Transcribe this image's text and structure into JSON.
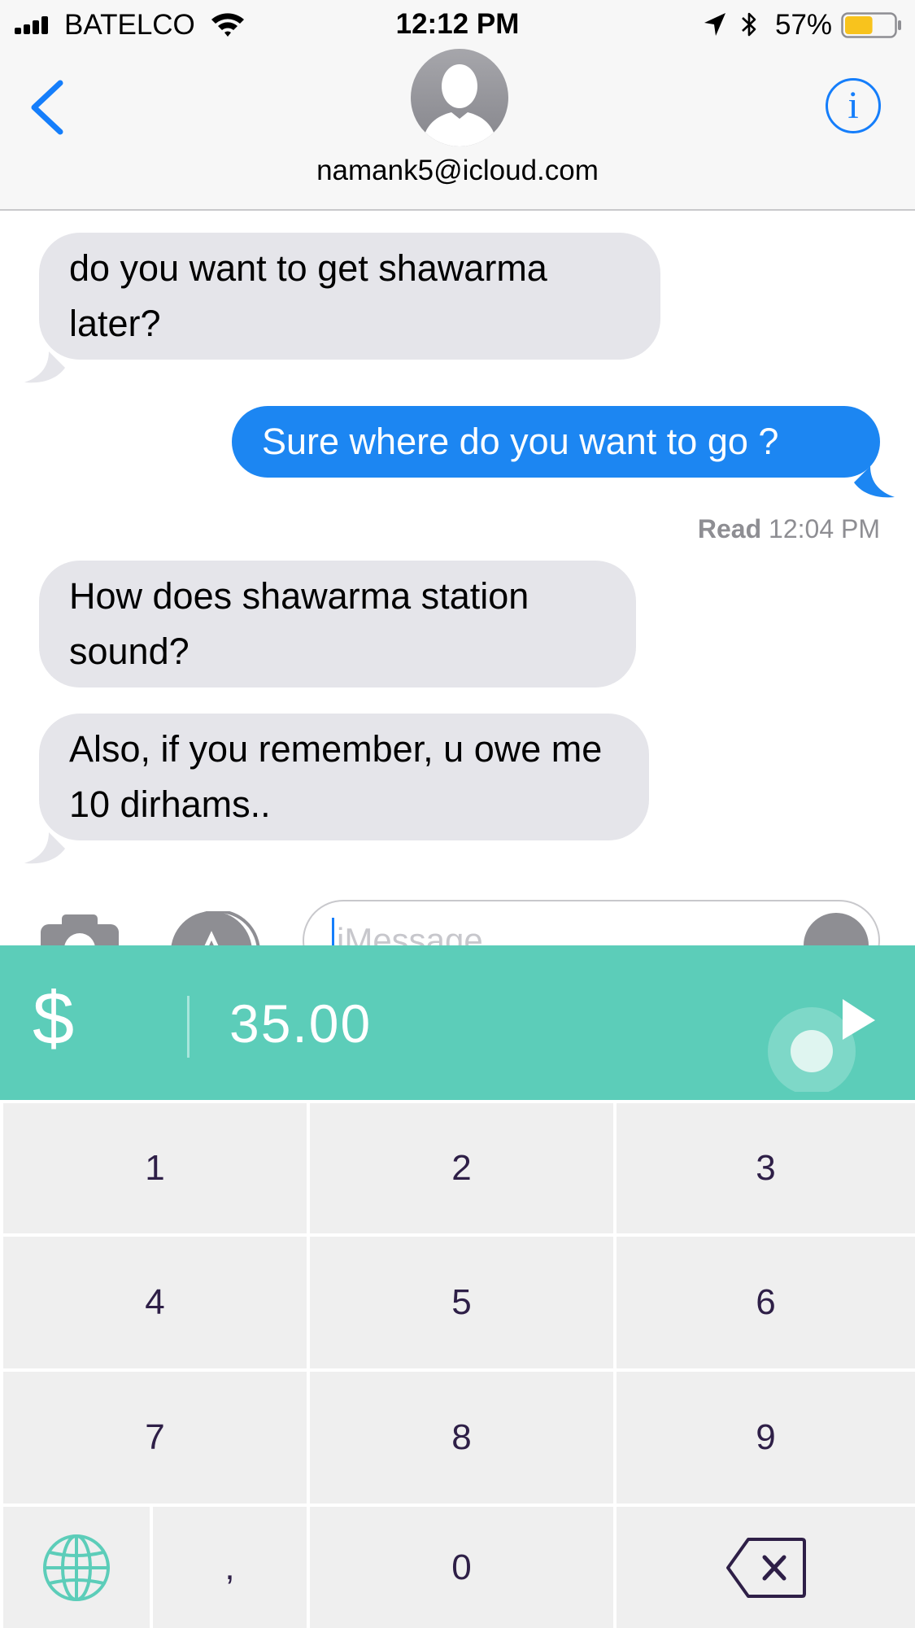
{
  "status_bar": {
    "carrier": "BATELCO",
    "time": "12:12 PM",
    "battery_percent": "57%",
    "battery_level": 0.57,
    "icons": [
      "signal-icon",
      "wifi-icon",
      "location-arrow-icon",
      "bluetooth-icon",
      "battery-icon"
    ]
  },
  "header": {
    "contact": "namank5@icloud.com",
    "back_icon": "chevron-left-icon",
    "info_label": "i",
    "avatar_icon": "person-silhouette-icon"
  },
  "messages": [
    {
      "direction": "incoming",
      "text": "do you want to get shawarma later?"
    },
    {
      "direction": "outgoing",
      "text": "Sure where do you want to go ?"
    },
    {
      "direction": "incoming",
      "text": "How does shawarma station sound?"
    },
    {
      "direction": "incoming",
      "text": "Also, if you remember, u owe me 10 dirhams.."
    }
  ],
  "read_receipt": {
    "label": "Read",
    "time": "12:04 PM"
  },
  "compose": {
    "placeholder": "iMessage",
    "icons": [
      "camera-icon",
      "app-store-icon",
      "microphone-icon"
    ]
  },
  "payment": {
    "currency": "$",
    "amount": "35.00",
    "send_icon": "play-arrow-icon"
  },
  "keypad": {
    "keys": [
      "1",
      "2",
      "3",
      "4",
      "5",
      "6",
      "7",
      "8",
      "9",
      ",",
      "0"
    ],
    "icons": [
      "globe-icon",
      "backspace-icon"
    ]
  },
  "colors": {
    "ios_blue": "#157efb",
    "outgoing_bubble": "#1c86f2",
    "incoming_bubble": "#e5e5ea",
    "payment_teal": "#5ccdb9",
    "key_background": "#efefef",
    "key_text": "#2e1f47"
  }
}
